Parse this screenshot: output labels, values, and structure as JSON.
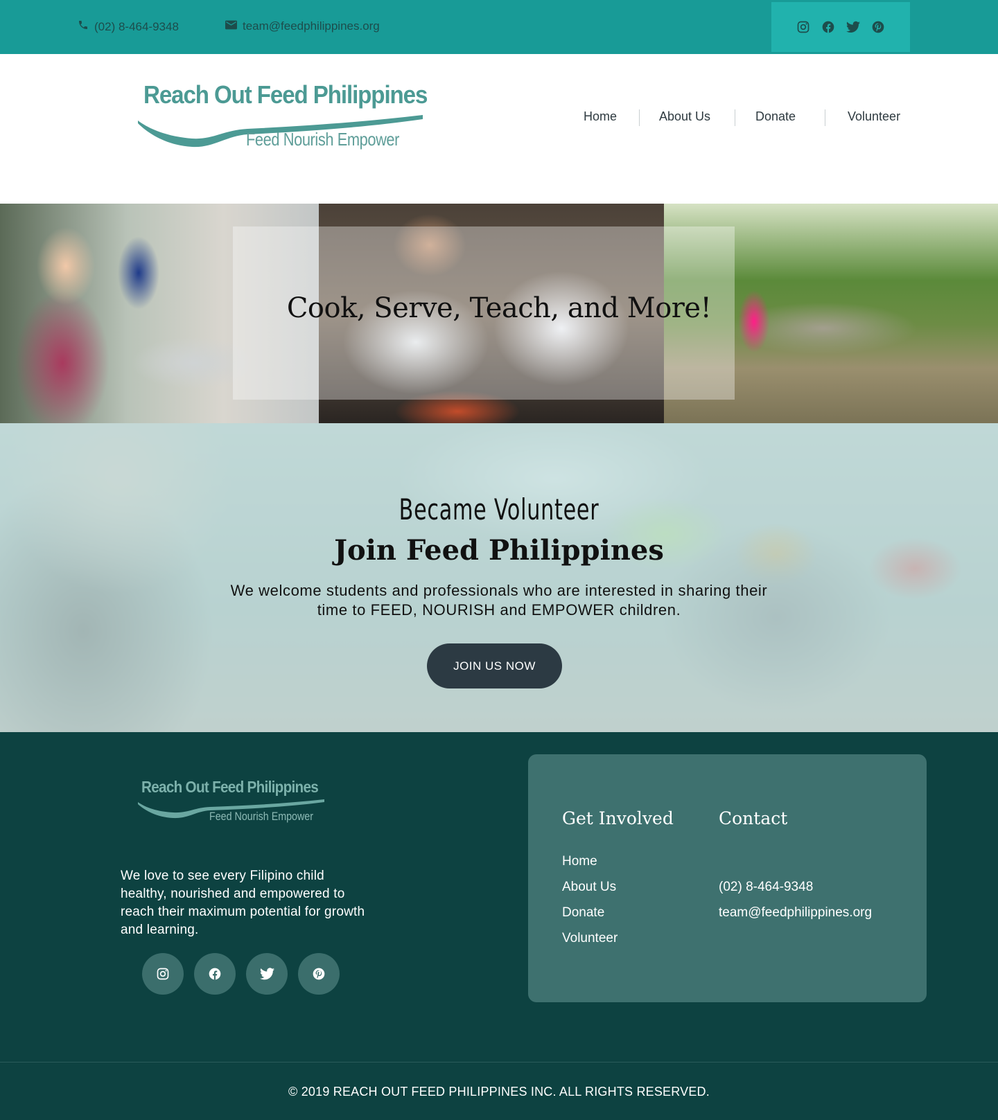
{
  "topbar": {
    "phone": "(02) 8-464-9348",
    "email": "team@feedphilippines.org",
    "social_icons": [
      "instagram-icon",
      "facebook-icon",
      "twitter-icon",
      "pinterest-icon"
    ]
  },
  "logo": {
    "title": "Reach Out Feed Philippines",
    "subtitle": "Feed Nourish Empower"
  },
  "nav": [
    "Home",
    "About Us",
    "Donate",
    "Volunteer"
  ],
  "hero": {
    "heading": "Cook, Serve, Teach, and More!"
  },
  "volunteer": {
    "kicker": "Became Volunteer",
    "heading": "Join Feed Philippines",
    "text": "We welcome students and professionals who are interested in sharing their time to FEED, NOURISH and EMPOWER children.",
    "button": "JOIN US NOW"
  },
  "footer": {
    "logo_title": "Reach Out Feed Philippines",
    "logo_subtitle": "Feed Nourish Empower",
    "tagline": "We love to see every Filipino child healthy, nourished and empowered to reach their maximum potential for growth and learning.",
    "get_involved": {
      "title": "Get Involved",
      "links": [
        "Home",
        "About Us",
        "Donate",
        "Volunteer"
      ]
    },
    "contact": {
      "title": "Contact",
      "phone": "(02) 8-464-9348",
      "email": "team@feedphilippines.org"
    },
    "copyright": "© 2019 REACH OUT FEED PHILIPPINES INC. ALL RIGHTS RESERVED."
  },
  "colors": {
    "topbar": "#189b97",
    "footer": "#0d4241",
    "card": "#3e716f",
    "button": "#2c3a43",
    "brand": "#4c9a94"
  }
}
